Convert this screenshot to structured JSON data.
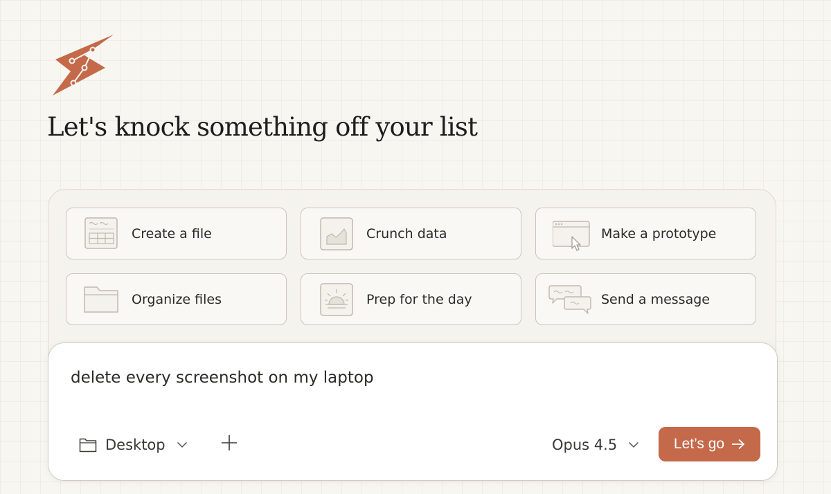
{
  "brand": {
    "logo_icon": "lightning-bolt-logo-icon",
    "accent_color": "#c4694a"
  },
  "headline": "Let's knock something off your list",
  "actions": [
    {
      "label": "Create a file",
      "icon": "spreadsheet-file-icon"
    },
    {
      "label": "Crunch data",
      "icon": "area-chart-icon"
    },
    {
      "label": "Make a prototype",
      "icon": "browser-cursor-icon"
    },
    {
      "label": "Organize files",
      "icon": "folder-icon"
    },
    {
      "label": "Prep for the day",
      "icon": "sunrise-icon"
    },
    {
      "label": "Send a message",
      "icon": "chat-bubbles-icon"
    }
  ],
  "composer": {
    "prompt_text": "delete every screenshot on my laptop",
    "folder_label": "Desktop",
    "model_label": "Opus 4.5",
    "submit_label": "Let’s go"
  }
}
